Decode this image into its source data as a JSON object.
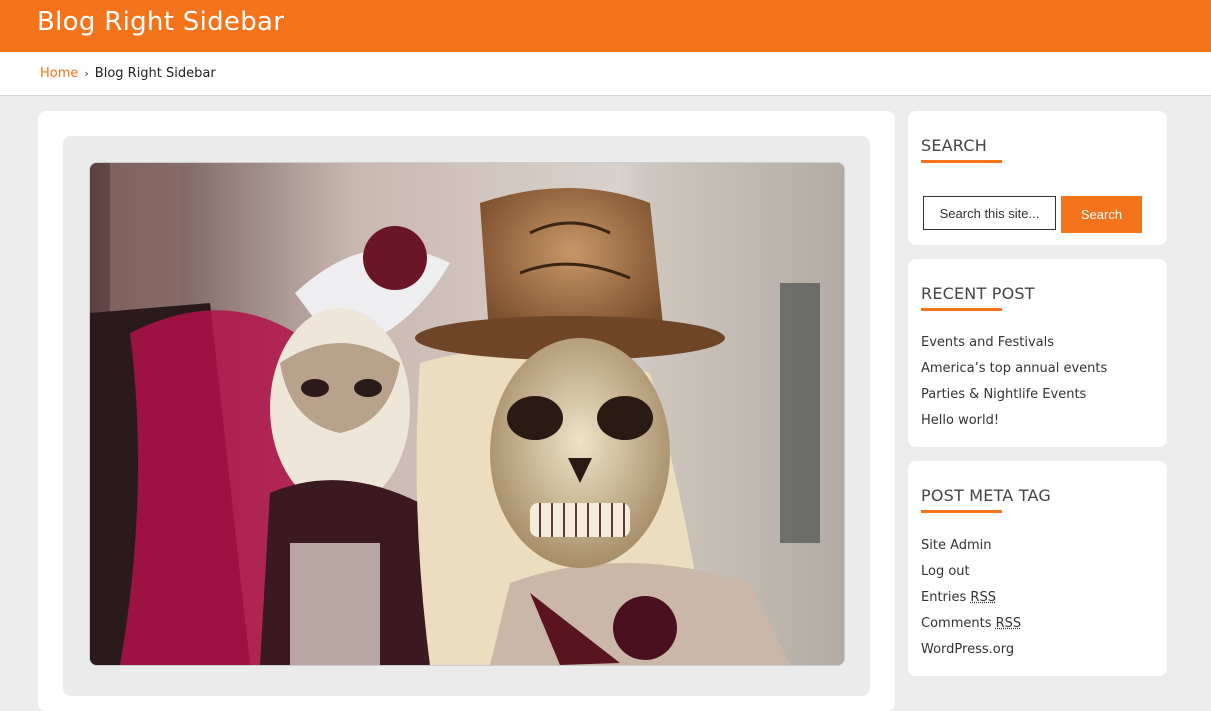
{
  "header": {
    "title": "Blog Right Sidebar"
  },
  "breadcrumb": {
    "home": "Home",
    "separator": "›",
    "current": "Blog Right Sidebar"
  },
  "colors": {
    "accent": "#f5731a",
    "background": "#ececec"
  },
  "post": {
    "image_alt": "Two people in ornate Venetian carnival masks and costumes"
  },
  "sidebar": {
    "search": {
      "title": "SEARCH",
      "placeholder": "Search this site...",
      "button": "Search"
    },
    "recent": {
      "title": "RECENT POST",
      "items": [
        "Events and Festivals",
        "America’s top annual events",
        "Parties & Nightlife Events",
        "Hello world!"
      ]
    },
    "meta": {
      "title": "POST META TAG",
      "items": [
        {
          "text": "Site Admin"
        },
        {
          "text": "Log out"
        },
        {
          "prefix": "Entries ",
          "abbr": "RSS"
        },
        {
          "prefix": "Comments ",
          "abbr": "RSS"
        },
        {
          "text": "WordPress.org"
        }
      ]
    }
  }
}
